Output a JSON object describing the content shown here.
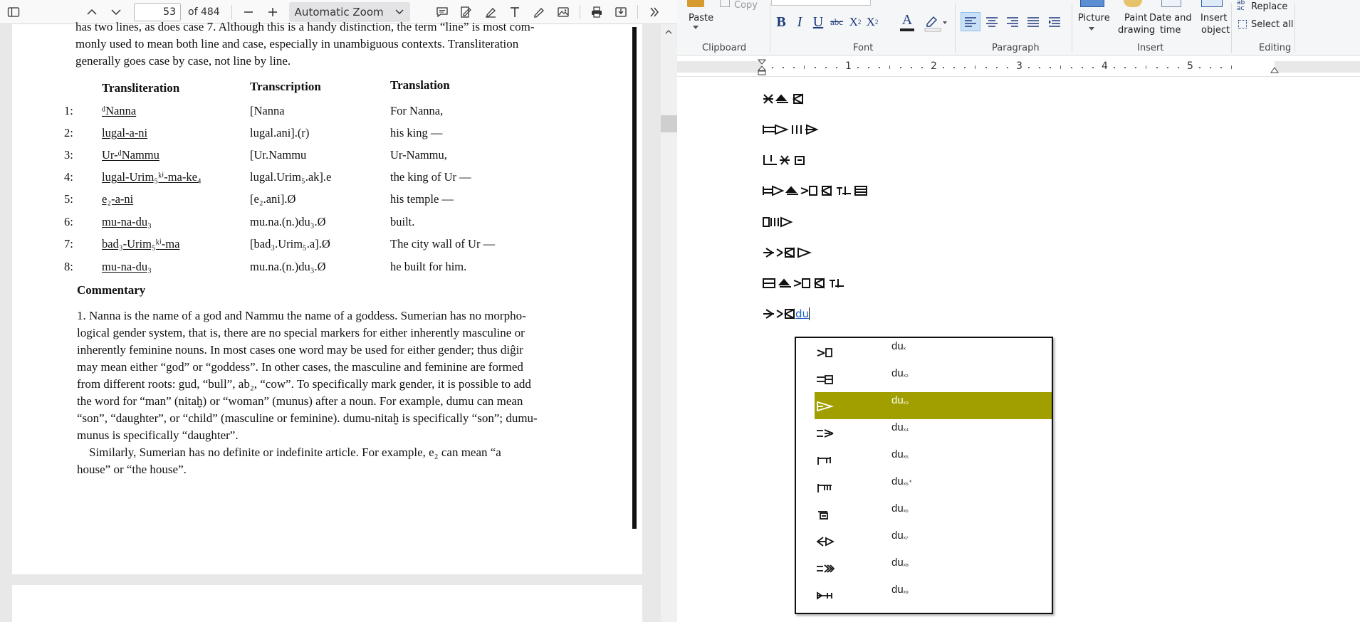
{
  "pdf_viewer": {
    "toolbar": {
      "current_page": "53",
      "page_count": "of 484",
      "zoom": "Automatic Zoom"
    },
    "intro_lines": [
      "has two lines, as does case 7. Although this is a handy distinction, the term “line” is most com-",
      "monly used to mean both line and case, especially in unambiguous contexts. Transliteration",
      "generally goes case by case, not line by line."
    ],
    "table": {
      "headers": [
        "Transliteration",
        "Transcription",
        "Translation"
      ],
      "rows": [
        {
          "num": "1:",
          "translit": "ᵈNanna",
          "transcr": "[Nanna",
          "transl": "For Nanna,"
        },
        {
          "num": "2:",
          "translit": "lugal-a-ni",
          "transcr": "lugal.ani].(r)",
          "transl": "his king —"
        },
        {
          "num": "3:",
          "translit": "Ur-ᵈNammu",
          "transcr": "[Ur.Nammu",
          "transl": "Ur-Nammu,"
        },
        {
          "num": "4:",
          "translit": "lugal-Urim₅ᵏⁱ-ma-ke₄",
          "transcr": "lugal.Urim₅.ak].e",
          "transl": "the king of Ur —"
        },
        {
          "num": "5:",
          "translit": "e₂-a-ni",
          "transcr": "[e₂.ani].Ø",
          "transl": "his temple —"
        },
        {
          "num": "6:",
          "translit": "mu-na-du₃",
          "transcr": "mu.na.(n.)du₃.Ø",
          "transl": "built."
        },
        {
          "num": "7:",
          "translit": "bad₃-Urim₅ᵏⁱ-ma",
          "transcr": "[bad₃.Urim₅.a].Ø",
          "transl": "The city wall of Ur —"
        },
        {
          "num": "8:",
          "translit": "mu-na-du₃",
          "transcr": "mu.na.(n.)du₃.Ø",
          "transl": "he built for him."
        }
      ]
    },
    "commentary_title": "Commentary",
    "commentary_lines": [
      "1.  Nanna is the name of a god and Nammu the name of a goddess. Sumerian has no morpho-",
      "logical gender system, that is, there are no special markers for either inherently masculine or",
      "inherently feminine nouns. In most cases one word may be used for either gender; thus diĝir",
      "may mean either “god” or “goddess”. In other cases, the masculine and feminine are formed",
      "from different roots: gud, “bull”, ab₂, “cow”. To specifically mark gender, it is possible to add",
      "the word for “man” (nitaḫ) or “woman” (munus) after a noun. For example, dumu can mean",
      "“son”, “daughter”, or “child” (masculine or feminine). dumu-nitaḫ is specifically “son”; dumu-",
      "munus is specifically “daughter”.",
      "    Similarly, Sumerian has no definite or indefinite article. For example, e₂ can mean “a",
      "house” or “the house”."
    ]
  },
  "wordpad": {
    "ribbon": {
      "paste": "Paste",
      "copy": "Copy",
      "clipboard_label": "Clipboard",
      "font_label": "Font",
      "paragraph_label": "Paragraph",
      "picture": "Picture",
      "paint": "Paint",
      "drawing": "drawing",
      "date_and": "Date and",
      "time": "time",
      "insert_obj": "Insert",
      "object": "object",
      "insert_label": "Insert",
      "replace": "Replace",
      "select_all": "Select all",
      "editing_label": "Editing",
      "bold": "B",
      "italic": "I",
      "underline": "U",
      "strike": "abc"
    },
    "ruler_numbers": [
      "1",
      "2",
      "3",
      "4",
      "5"
    ],
    "typed_text": "du"
  },
  "autocomplete": {
    "items": [
      {
        "label": "du",
        "sub": "ₓ"
      },
      {
        "label": "du",
        "sub": "ₓ₂"
      },
      {
        "label": "du",
        "sub": "ₓ₃"
      },
      {
        "label": "du",
        "sub": "ₓ₄"
      },
      {
        "label": "du",
        "sub": "ₓ₅"
      },
      {
        "label": "du",
        "sub": "ₓ₅⁺"
      },
      {
        "label": "du",
        "sub": "ₓ₆"
      },
      {
        "label": "du",
        "sub": "ₓ₇"
      },
      {
        "label": "du",
        "sub": "ₓ₈"
      },
      {
        "label": "du",
        "sub": "ₓ₉"
      }
    ],
    "selected_index": 2,
    "selected_color": "#a19f00"
  }
}
